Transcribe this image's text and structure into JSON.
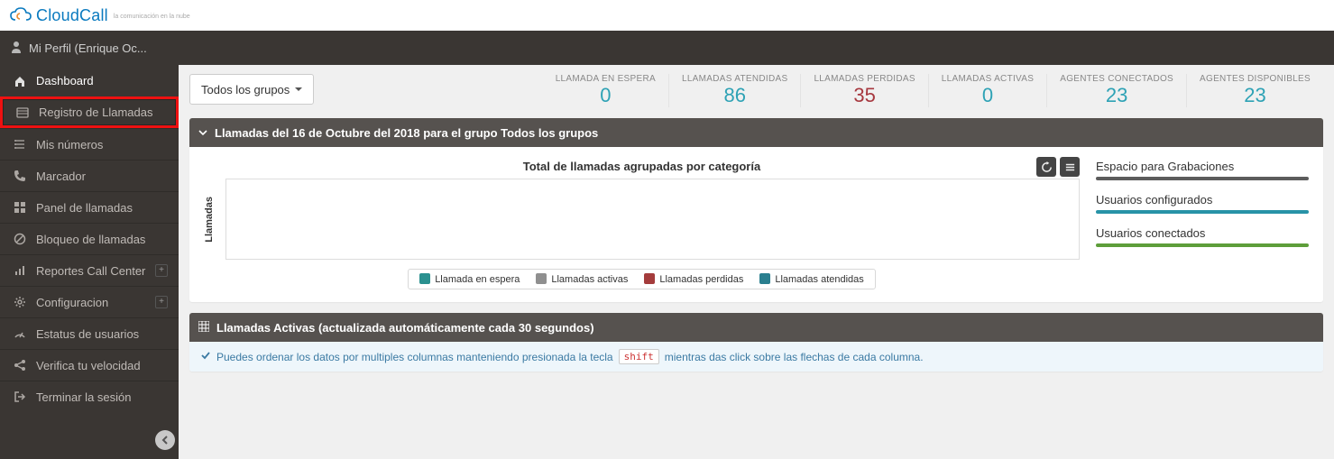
{
  "brand": {
    "name": "CloudCall",
    "tagline": "la comunicación en la nube"
  },
  "profile": {
    "label": "Mi Perfil (Enrique Oc..."
  },
  "sidebar": {
    "items": [
      {
        "icon": "home",
        "label": "Dashboard",
        "active": true
      },
      {
        "icon": "list",
        "label": "Registro de Llamadas",
        "highlight": true
      },
      {
        "icon": "hash",
        "label": "Mis números"
      },
      {
        "icon": "phone",
        "label": "Marcador"
      },
      {
        "icon": "grid",
        "label": "Panel de llamadas"
      },
      {
        "icon": "ban",
        "label": "Bloqueo de llamadas"
      },
      {
        "icon": "chart",
        "label": "Reportes Call Center",
        "expandable": true
      },
      {
        "icon": "gear",
        "label": "Configuracion",
        "expandable": true
      },
      {
        "icon": "gauge",
        "label": "Estatus de usuarios"
      },
      {
        "icon": "share",
        "label": "Verifica tu velocidad"
      },
      {
        "icon": "logout",
        "label": "Terminar la sesión"
      }
    ]
  },
  "group_filter": {
    "label": "Todos los grupos"
  },
  "stats": [
    {
      "label": "LLAMADA EN ESPERA",
      "value": "0",
      "color": "c-teal"
    },
    {
      "label": "LLAMADAS ATENDIDAS",
      "value": "86",
      "color": "c-teal"
    },
    {
      "label": "LLAMADAS PERDIDAS",
      "value": "35",
      "color": "c-red"
    },
    {
      "label": "LLAMADAS ACTIVAS",
      "value": "0",
      "color": "c-teal"
    },
    {
      "label": "AGENTES CONECTADOS",
      "value": "23",
      "color": "c-teal"
    },
    {
      "label": "AGENTES DISPONIBLES",
      "value": "23",
      "color": "c-teal"
    }
  ],
  "panel_calls": {
    "header": "Llamadas del 16 de Octubre del 2018 para el grupo Todos los grupos",
    "chart_title": "Total de llamadas agrupadas por categoría",
    "ylabel": "Llamadas",
    "legend": [
      {
        "cls": "sw-wait",
        "label": "Llamada en espera"
      },
      {
        "cls": "sw-active",
        "label": "Llamadas activas"
      },
      {
        "cls": "sw-lost",
        "label": "Llamadas perdidas"
      },
      {
        "cls": "sw-att",
        "label": "Llamadas atendidas"
      }
    ],
    "side_metrics": [
      {
        "label": "Espacio para Grabaciones",
        "bar": "bar-gray"
      },
      {
        "label": "Usuarios configurados",
        "bar": "bar-teal"
      },
      {
        "label": "Usuarios conectados",
        "bar": "bar-green"
      }
    ]
  },
  "panel_active": {
    "header": "Llamadas Activas (actualizada automáticamente cada 30 segundos)",
    "tip_pre": "Puedes ordenar los datos por multiples columnas manteniendo presionada la tecla",
    "tip_kbd": "shift",
    "tip_post": "mientras das click sobre las flechas de cada columna."
  },
  "chart_data": {
    "type": "bar",
    "title": "Total de llamadas agrupadas por categoría",
    "ylabel": "Llamadas",
    "xlabel": "",
    "categories": [],
    "series": [
      {
        "name": "Llamada en espera",
        "values": []
      },
      {
        "name": "Llamadas activas",
        "values": []
      },
      {
        "name": "Llamadas perdidas",
        "values": []
      },
      {
        "name": "Llamadas atendidas",
        "values": []
      }
    ],
    "ylim": null,
    "note": "No data points rendered in the screenshot"
  }
}
